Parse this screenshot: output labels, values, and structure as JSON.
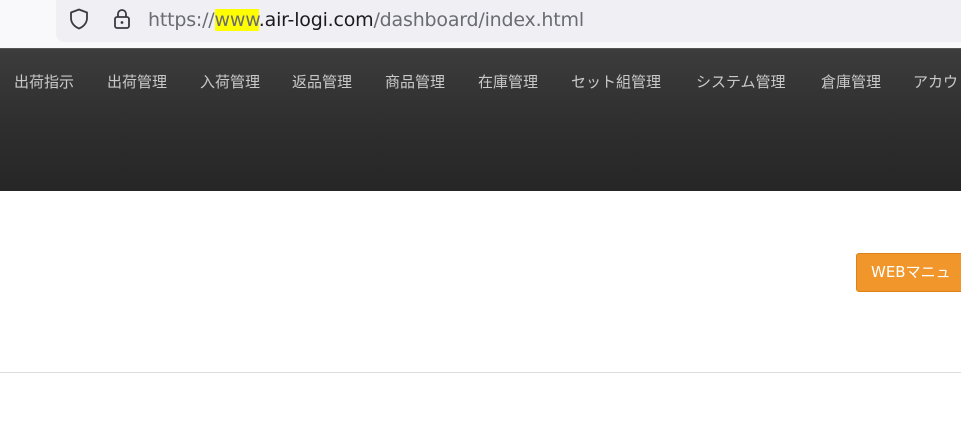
{
  "browser": {
    "url": {
      "scheme": "https://",
      "subdomain": "www",
      "host": ".air-logi.com",
      "path": "/dashboard/index.html"
    },
    "icons": [
      "shield-icon",
      "lock-icon"
    ],
    "highlight_color": "#ffff00"
  },
  "nav": {
    "items": [
      "出荷指示",
      "出荷管理",
      "入荷管理",
      "返品管理",
      "商品管理",
      "在庫管理",
      "セット組管理",
      "システム管理",
      "倉庫管理",
      "アカウ"
    ]
  },
  "main": {
    "manual_button_label": "WEBマニュ"
  },
  "colors": {
    "nav_background": "#2e2e2e",
    "nav_text": "#c9c9c9",
    "button_orange": "#f0962a"
  }
}
